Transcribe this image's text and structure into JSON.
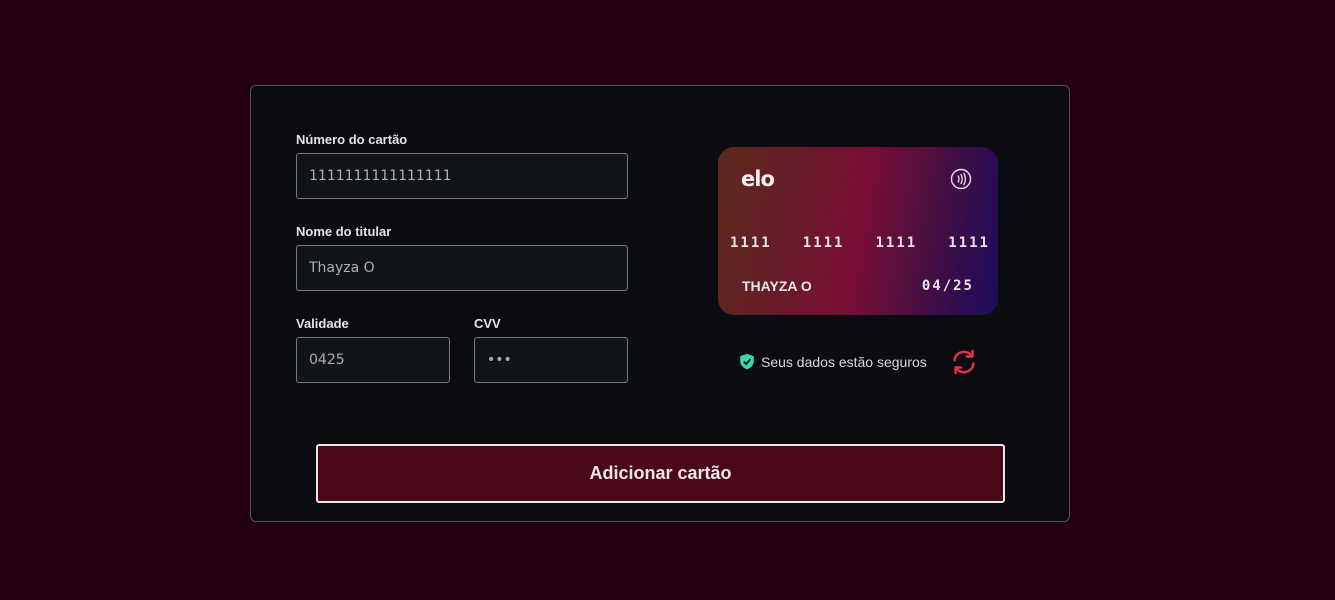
{
  "form": {
    "card_number": {
      "label": "Número do cartão",
      "value": "1111111111111111"
    },
    "holder_name": {
      "label": "Nome do titular",
      "value": "Thayza O"
    },
    "expiry": {
      "label": "Validade",
      "value": "0425"
    },
    "cvv": {
      "label": "CVV",
      "value": "•••"
    }
  },
  "card_preview": {
    "brand": "elo",
    "number_groups": [
      "1111",
      "1111",
      "1111",
      "1111"
    ],
    "holder": "THAYZA O",
    "expiry": "04/25",
    "icons": {
      "contactless": "contactless-icon"
    }
  },
  "security": {
    "text": "Seus dados estão seguros",
    "icon": "shield-check-icon",
    "refresh_icon": "refresh-icon"
  },
  "submit_label": "Adicionar cartão",
  "colors": {
    "background": "#230112",
    "panel": "#0a0c11",
    "button": "#4a0819",
    "shield": "#38d9a9",
    "refresh": "#e0324f"
  }
}
